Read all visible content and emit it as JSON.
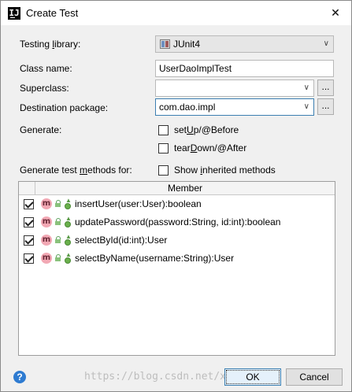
{
  "window": {
    "title": "Create Test",
    "app_icon": "intellij-icon",
    "close_glyph": "✕"
  },
  "form": {
    "testing_library": {
      "label_pre": "Testing ",
      "label_mn": "l",
      "label_post": "ibrary:",
      "value": "JUnit4"
    },
    "class_name": {
      "label": "Class name:",
      "value": "UserDaoImplTest"
    },
    "superclass": {
      "label": "Superclass:",
      "value": ""
    },
    "destination_package": {
      "label": "Destination package:",
      "value": "com.dao.impl"
    },
    "generate": {
      "label": "Generate:",
      "setup": {
        "pre": "set",
        "mn": "U",
        "post": "p/@Before",
        "checked": false
      },
      "teardown": {
        "pre": "tear",
        "mn": "D",
        "post": "own/@After",
        "checked": false
      }
    },
    "methods_label": {
      "pre": "Generate test ",
      "mn": "m",
      "post": "ethods for:"
    },
    "show_inherited": {
      "pre": "Show ",
      "mn": "i",
      "post": "nherited methods",
      "checked": false
    },
    "browse_label": "..."
  },
  "members_table": {
    "header": "Member",
    "rows": [
      {
        "checked": true,
        "icon": "m",
        "text": "insertUser(user:User):boolean"
      },
      {
        "checked": true,
        "icon": "m",
        "text": "updatePassword(password:String, id:int):boolean"
      },
      {
        "checked": true,
        "icon": "m",
        "text": "selectById(id:int):User"
      },
      {
        "checked": true,
        "icon": "m",
        "text": "selectByName(username:String):User"
      }
    ]
  },
  "footer": {
    "help": "?",
    "watermark": "https://blog.csdn.net/xiaodong17",
    "ok": "OK",
    "cancel": "Cancel"
  },
  "colors": {
    "accent": "#3c7fb1",
    "method_icon": "#f2a8b4",
    "help": "#2e7bd1"
  }
}
